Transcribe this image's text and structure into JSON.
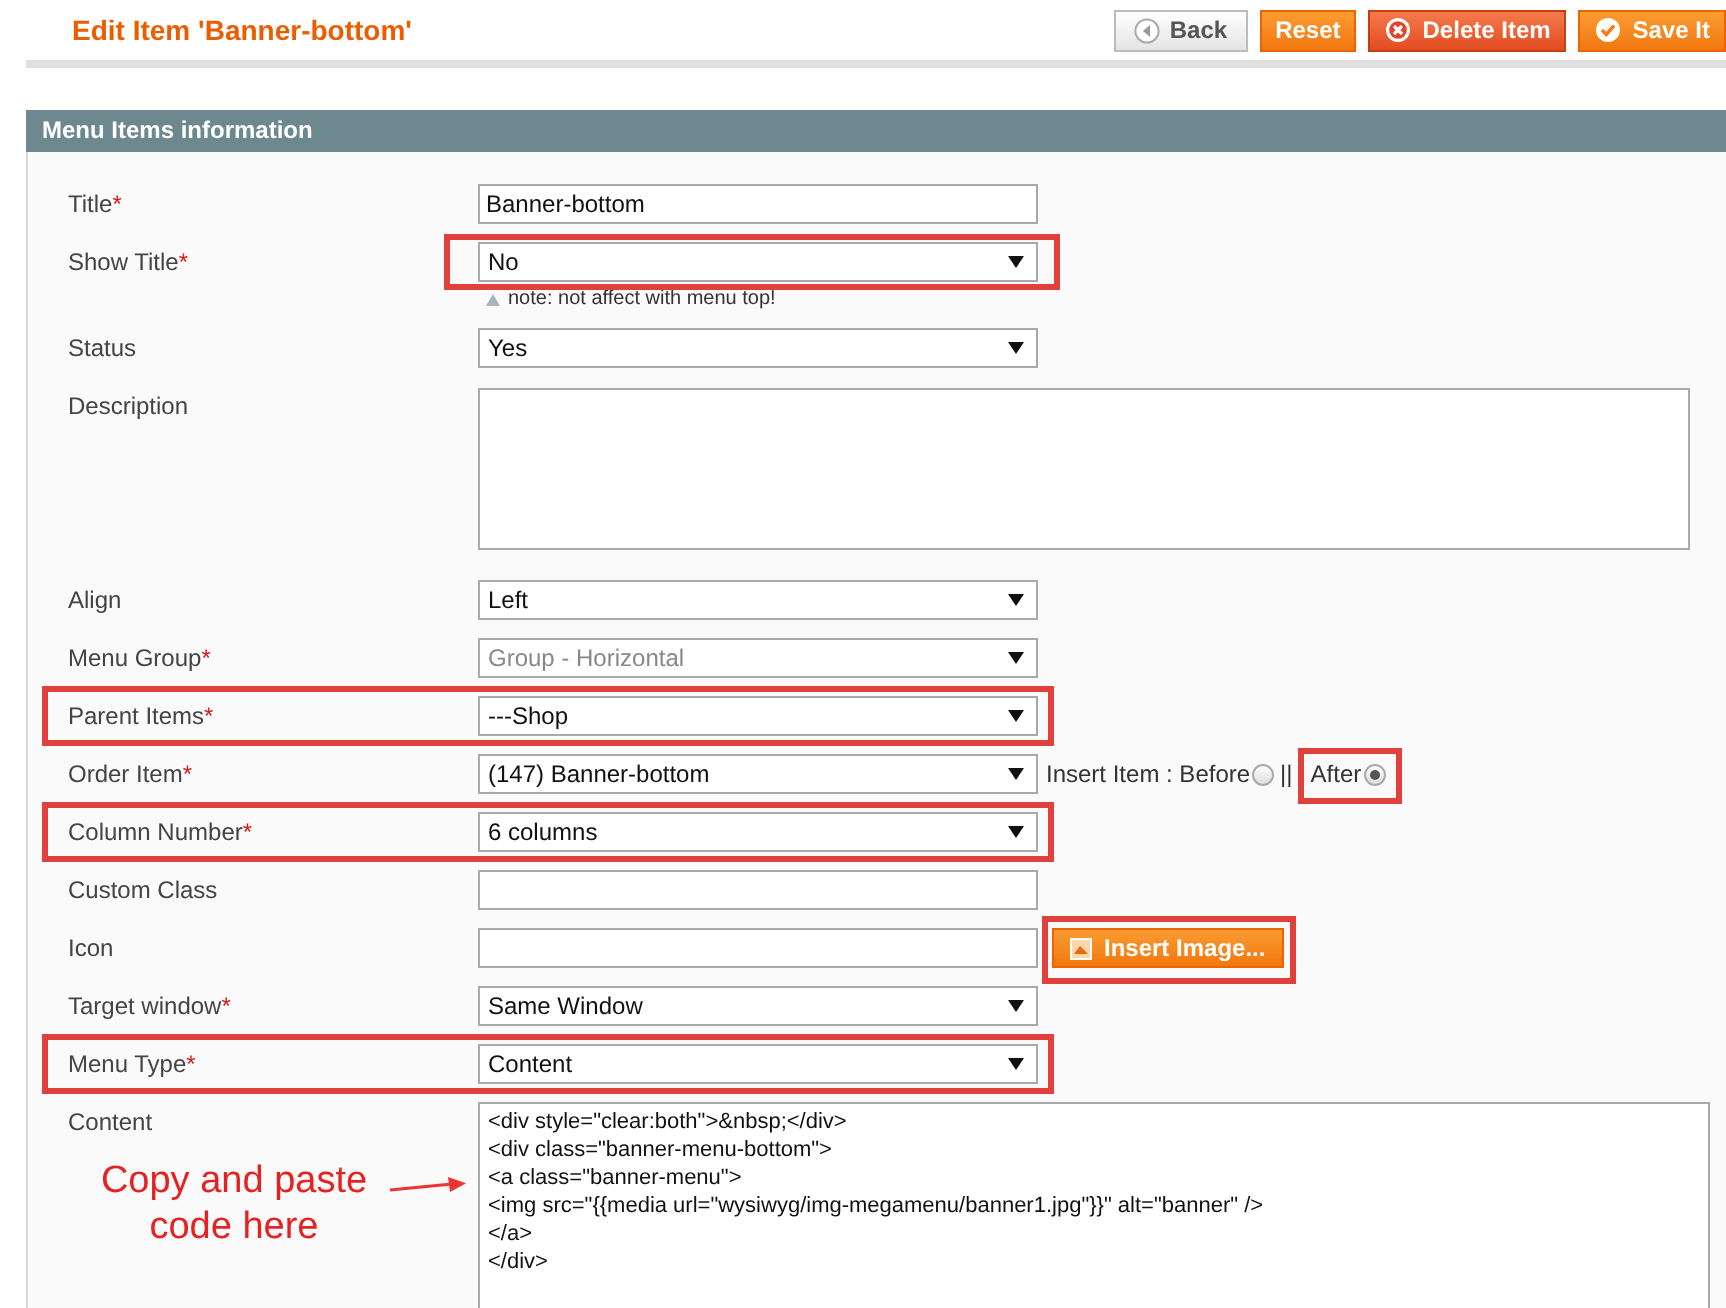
{
  "page_title": "Edit Item 'Banner-bottom'",
  "buttons": [
    {
      "label": "Back",
      "kind": "back"
    },
    {
      "label": "Reset",
      "kind": "plain"
    },
    {
      "label": "Delete Item",
      "kind": "delete"
    },
    {
      "label": "Save It",
      "kind": "save"
    }
  ],
  "section": {
    "title": "Menu Items information"
  },
  "fields": [
    {
      "label": "Title",
      "mark": "*",
      "kind": "text",
      "value": "Banner-bottom",
      "disabled": false,
      "highlighted": false
    },
    {
      "label": "Show Title",
      "mark": "*",
      "kind": "select",
      "value": "No",
      "disabled": false,
      "highlighted": true,
      "highlight_label": false,
      "note": "note: not affect with menu top!"
    },
    {
      "label": "Status",
      "kind": "select",
      "value": "Yes",
      "disabled": false,
      "highlighted": false
    },
    {
      "label": "Description",
      "kind": "textarea",
      "disabled": false,
      "highlighted": false
    },
    {
      "label": "Align",
      "kind": "select",
      "value": "Left",
      "disabled": false,
      "highlighted": false
    },
    {
      "label": "Menu Group",
      "mark": "*",
      "kind": "select",
      "value": "Group - Horizontal",
      "disabled": true,
      "highlighted": false
    },
    {
      "label": "Parent Items",
      "mark": "*",
      "kind": "select",
      "value": "---Shop",
      "disabled": false,
      "highlighted": true,
      "highlight_label": true
    },
    {
      "label": "Order Item",
      "mark": "*",
      "kind": "select",
      "value": "(147) Banner-bottom",
      "disabled": false,
      "highlighted": false,
      "options": [
        {
          "label": "Insert Item : Before",
          "selected": false,
          "highlighted": false
        },
        {
          "label": "After",
          "selected": true,
          "highlighted": true
        }
      ],
      "separator": "||"
    },
    {
      "label": "Column Number",
      "mark": "*",
      "kind": "select",
      "value": "6 columns",
      "disabled": false,
      "highlighted": true,
      "highlight_label": true
    },
    {
      "label": "Custom Class",
      "kind": "text",
      "disabled": false,
      "highlighted": false
    },
    {
      "label": "Icon",
      "kind": "text",
      "disabled": false,
      "highlighted": false,
      "button": {
        "label": "Insert Image...",
        "highlighted": true
      }
    },
    {
      "label": "Target window",
      "mark": "*",
      "kind": "select",
      "value": "Same Window",
      "disabled": false,
      "highlighted": false
    },
    {
      "label": "Menu Type",
      "mark": "*",
      "kind": "select",
      "value": "Content",
      "disabled": false,
      "highlighted": true,
      "highlight_label": true
    },
    {
      "label": "Content",
      "kind": "code",
      "disabled": false,
      "highlighted": false,
      "lines": [
        "<div style=\"clear:both\">&nbsp;</div>",
        "<div class=\"banner-menu-bottom\">",
        "<a class=\"banner-menu\">",
        "<img src=\"{{media url=\"wysiwyg/img-megamenu/banner1.jpg\"}}\" alt=\"banner\" />",
        "</a>",
        "</div>"
      ],
      "annotation": "Copy and paste code here"
    }
  ]
}
